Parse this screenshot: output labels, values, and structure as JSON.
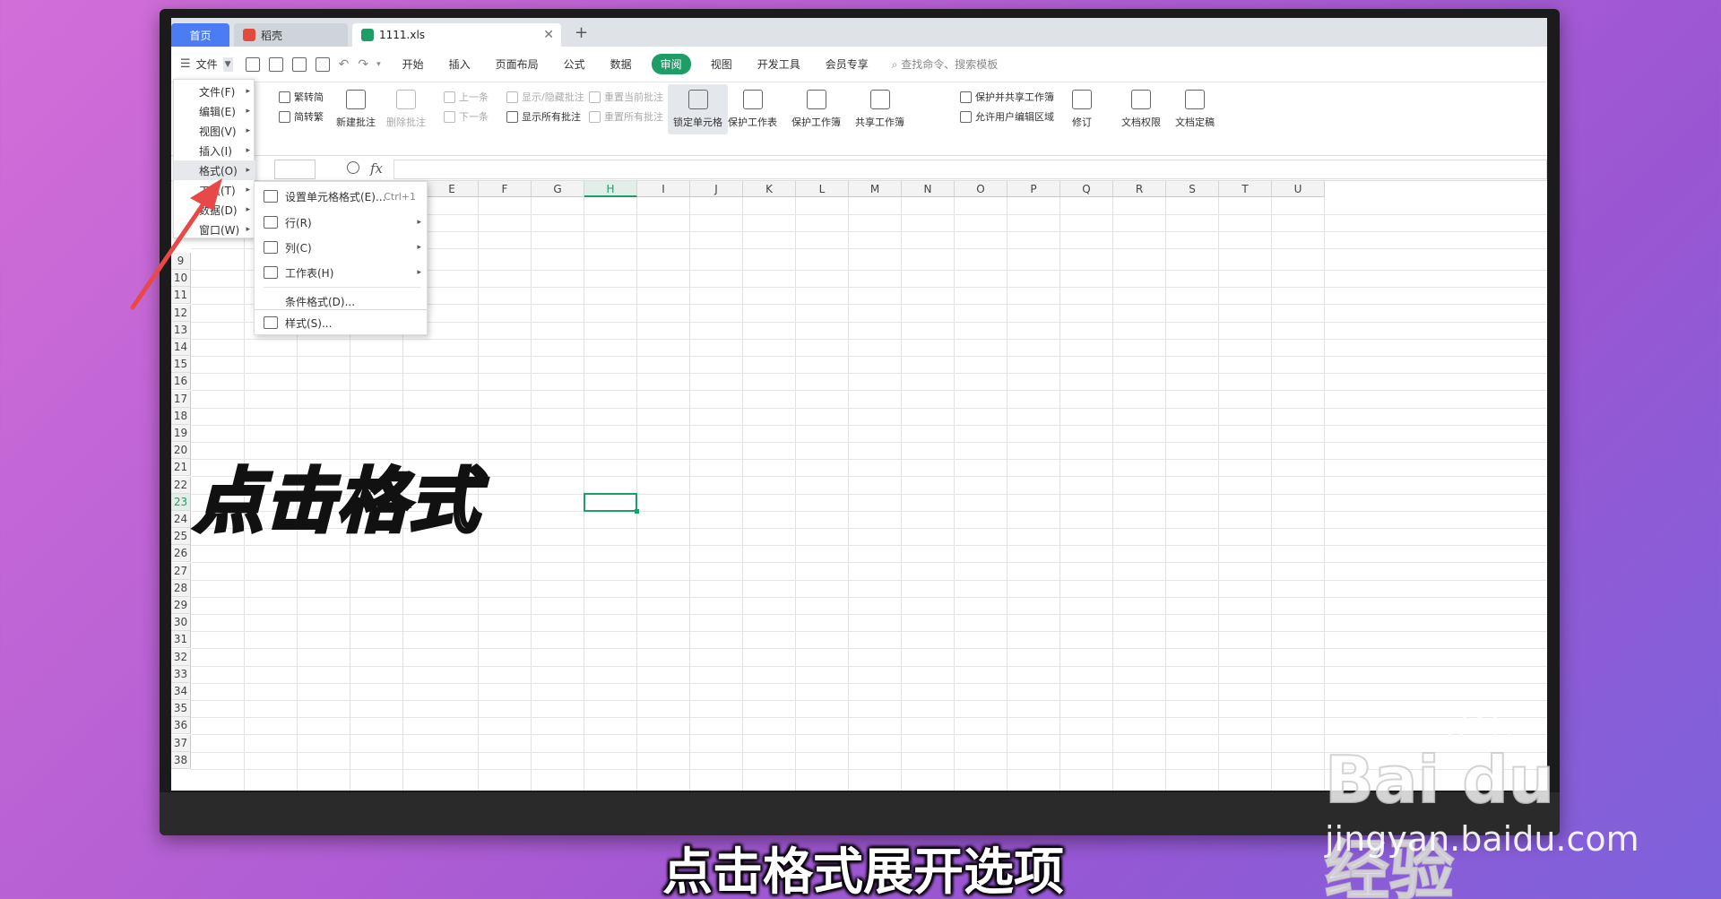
{
  "tabs": {
    "home": "首页",
    "docer": "稻壳",
    "file": "1111.xls",
    "new_tab": "+"
  },
  "menubar": {
    "file_label": "文件",
    "items": [
      "开始",
      "插入",
      "页面布局",
      "公式",
      "数据",
      "审阅",
      "视图",
      "开发工具",
      "会员专享"
    ],
    "active": "审阅",
    "search_placeholder": "查找命令、搜索模板"
  },
  "ribbon": {
    "trad_to_simp": "繁转简",
    "simp_to_trad": "简转繁",
    "new_comment": "新建批注",
    "delete_comment": "删除批注",
    "prev": "上一条",
    "next": "下一条",
    "show_hide_comment": "显示/隐藏批注",
    "show_all_comments": "显示所有批注",
    "reset_current_comment": "重置当前批注",
    "reset_all_comments": "重置所有批注",
    "lock_cell": "锁定单元格",
    "protect_sheet": "保护工作表",
    "protect_workbook": "保护工作簿",
    "share_workbook": "共享工作簿",
    "protect_share_workbook": "保护并共享工作簿",
    "allow_edit_ranges": "允许用户编辑区域",
    "revise": "修订",
    "doc_permission": "文档权限",
    "doc_finalize": "文档定稿"
  },
  "formula_bar": {
    "fx": "fx",
    "name_box": "",
    "content": ""
  },
  "columns": [
    "E",
    "F",
    "G",
    "H",
    "I",
    "J",
    "K",
    "L",
    "M",
    "N",
    "O",
    "P",
    "Q",
    "R",
    "S",
    "T",
    "U"
  ],
  "selected_column": "H",
  "rows": [
    "9",
    "10",
    "11",
    "12",
    "13",
    "14",
    "15",
    "16",
    "17",
    "18",
    "19",
    "20",
    "21",
    "22",
    "23",
    "24",
    "25",
    "26",
    "27",
    "28",
    "29",
    "30",
    "31",
    "32",
    "33",
    "34",
    "35",
    "36",
    "37",
    "38"
  ],
  "selected_row": "23",
  "file_menu": {
    "items": [
      {
        "label": "文件(F)"
      },
      {
        "label": "编辑(E)"
      },
      {
        "label": "视图(V)"
      },
      {
        "label": "插入(I)"
      },
      {
        "label": "格式(O)"
      },
      {
        "label": "工具(T)"
      },
      {
        "label": "数据(D)"
      },
      {
        "label": "窗口(W)"
      }
    ],
    "hovered": "格式(O)"
  },
  "format_submenu": {
    "cell_format": "设置单元格格式(E)...",
    "cell_format_shortcut": "Ctrl+1",
    "row": "行(R)",
    "column": "列(C)",
    "sheet": "工作表(H)",
    "conditional": "条件格式(D)...",
    "style": "样式(S)..."
  },
  "overlay": {
    "caption": "点击格式",
    "subtitle": "点击格式展开选项",
    "watermark_logo": "Bai du 经验",
    "watermark_url": "jingyan.baidu.com"
  },
  "colors": {
    "accent": "#1f9d66",
    "home_tab": "#4b7cf3",
    "arrow": "#e84848"
  }
}
